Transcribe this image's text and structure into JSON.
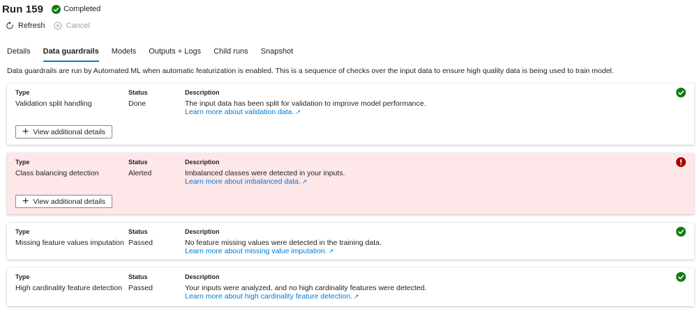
{
  "header": {
    "title": "Run 159",
    "status": "Completed"
  },
  "toolbar": {
    "refresh_label": "Refresh",
    "cancel_label": "Cancel"
  },
  "tabs": [
    {
      "label": "Details",
      "active": false
    },
    {
      "label": "Data guardrails",
      "active": true
    },
    {
      "label": "Models",
      "active": false
    },
    {
      "label": "Outputs + Logs",
      "active": false
    },
    {
      "label": "Child runs",
      "active": false
    },
    {
      "label": "Snapshot",
      "active": false
    }
  ],
  "intro": "Data guardrails are run by Automated ML when automatic featurization is enabled. This is a sequence of checks over the input data to ensure high quality data is being used to train model.",
  "columns": {
    "type": "Type",
    "status": "Status",
    "description": "Description"
  },
  "details_button_label": "View additional details",
  "colors": {
    "accent": "#0078d4",
    "success": "#107c10",
    "alert": "#a80000",
    "alert_bg": "#fde7e9"
  },
  "guardrails": [
    {
      "type": "Validation split handling",
      "status": "Done",
      "description": "The input data has been split for validation to improve model performance.",
      "link": "Learn more about validation data.",
      "state": "success",
      "icon": "check-circle-icon"
    },
    {
      "type": "Class balancing detection",
      "status": "Alerted",
      "description": "Imbalanced classes were detected in your inputs.",
      "link": "Learn more about imbalanced data.",
      "state": "alert",
      "icon": "error-circle-icon"
    },
    {
      "type": "Missing feature values imputation",
      "status": "Passed",
      "description": "No feature missing values were detected in the training data.",
      "link": "Learn more about missing value imputation.",
      "state": "success",
      "icon": "check-circle-icon"
    },
    {
      "type": "High cardinality feature detection",
      "status": "Passed",
      "description": "Your inputs were analyzed, and no high cardinality features were detected.",
      "link": "Learn more about high cardinality feature detection.",
      "state": "success",
      "icon": "check-circle-icon"
    }
  ]
}
